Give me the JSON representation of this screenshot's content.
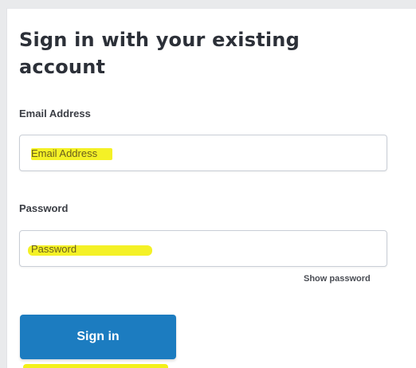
{
  "form": {
    "title": "Sign in with your existing account",
    "email": {
      "label": "Email Address",
      "placeholder": "Email Address",
      "value": ""
    },
    "password": {
      "label": "Password",
      "placeholder": "Password",
      "value": ""
    },
    "show_password_label": "Show password",
    "submit_label": "Sign in"
  },
  "colors": {
    "button": "#1c7cc0",
    "highlight": "#f3f01a",
    "title": "#2c3038"
  }
}
